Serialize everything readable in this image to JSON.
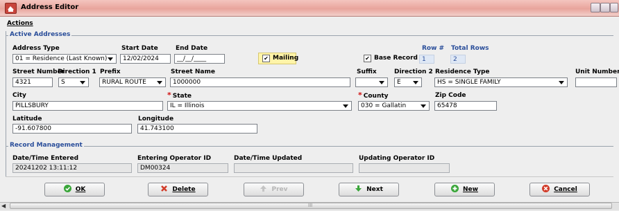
{
  "window": {
    "title": "Address Editor"
  },
  "menu": {
    "actions": "Actions"
  },
  "active_addresses": {
    "section_title": "Active Addresses",
    "address_type": {
      "label": "Address Type",
      "value": "01 = Residence (Last Known)"
    },
    "start_date": {
      "label": "Start Date",
      "value": "12/02/2024"
    },
    "end_date": {
      "label": "End Date",
      "value": "__/__/____"
    },
    "mailing": {
      "label": "Mailing",
      "checked": true
    },
    "base_record": {
      "label": "Base Record",
      "checked": true
    },
    "row_num": {
      "label": "Row #",
      "value": "1"
    },
    "total_rows": {
      "label": "Total Rows",
      "value": "2"
    },
    "street_number": {
      "label": "Street Number",
      "value": "4321"
    },
    "direction1": {
      "label": "Direction 1",
      "value": "S"
    },
    "prefix": {
      "label": "Prefix",
      "value": "RURAL ROUTE"
    },
    "street_name": {
      "label": "Street Name",
      "value": "1000000"
    },
    "suffix": {
      "label": "Suffix",
      "value": ""
    },
    "direction2": {
      "label": "Direction 2",
      "value": "E"
    },
    "residence_type": {
      "label": "Residence Type",
      "value": "HS = SINGLE FAMILY"
    },
    "unit_number": {
      "label": "Unit Number",
      "value": ""
    },
    "city": {
      "label": "City",
      "value": "PILLSBURY"
    },
    "state": {
      "label": "State",
      "value": "IL = Illinois",
      "required": "*"
    },
    "county": {
      "label": "County",
      "value": "030 = Gallatin",
      "required": "*"
    },
    "zip": {
      "label": "Zip Code",
      "value": "65478"
    },
    "latitude": {
      "label": "Latitude",
      "value": "-91.607800"
    },
    "longitude": {
      "label": "Longitude",
      "value": "41.743100"
    }
  },
  "record_management": {
    "section_title": "Record Management",
    "datetime_entered": {
      "label": "Date/Time Entered",
      "value": "20241202 13:11:12"
    },
    "entering_operator": {
      "label": "Entering Operator ID",
      "value": "DM00324"
    },
    "datetime_updated": {
      "label": "Date/Time Updated",
      "value": ""
    },
    "updating_operator": {
      "label": "Updating Operator ID",
      "value": ""
    }
  },
  "buttons": {
    "ok": "OK",
    "delete": "Delete",
    "prev": "Prev",
    "next": "Next",
    "new": "New",
    "cancel": "Cancel"
  },
  "scrollbar": {
    "grip": "III"
  },
  "colors": {
    "accent": "#2a4e9a",
    "required": "#d01010",
    "mailing_highlight": "#fff4a8"
  }
}
